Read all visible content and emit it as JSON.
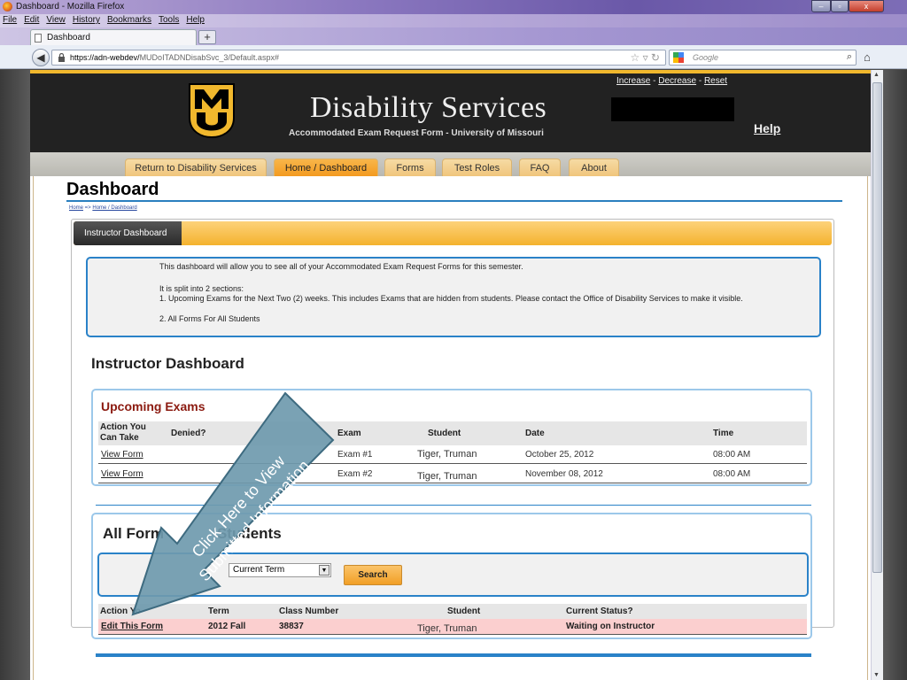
{
  "window": {
    "title": "Dashboard - Mozilla Firefox",
    "controls": {
      "minimize": "–",
      "maximize": "▫",
      "close": "x"
    }
  },
  "menu": [
    "File",
    "Edit",
    "View",
    "History",
    "Bookmarks",
    "Tools",
    "Help"
  ],
  "browser_tab": {
    "title": "Dashboard",
    "new_tab": "+"
  },
  "address": {
    "host": "https://adn-webdev/",
    "path": "MUDoITADNDisabSvc_3/Default.aspx#"
  },
  "search": {
    "placeholder": "Google"
  },
  "site": {
    "title": "Disability Services",
    "subtitle": "Accommodated Exam Request Form - University of Missouri",
    "font_controls": {
      "increase": "Increase",
      "sep": " - ",
      "decrease": "Decrease",
      "reset": "Reset"
    },
    "help": "Help"
  },
  "nav_tabs": [
    {
      "label": "Return to Disability Services"
    },
    {
      "label": "Home / Dashboard",
      "active": true
    },
    {
      "label": "Forms"
    },
    {
      "label": "Test Roles"
    },
    {
      "label": "FAQ"
    },
    {
      "label": "About"
    }
  ],
  "page": {
    "title": "Dashboard",
    "breadcrumb": {
      "home": "Home",
      "arrow": " => ",
      "current": "Home / Dashboard"
    },
    "panel_tab": "Instructor Dashboard",
    "intro": {
      "line1": "This dashboard will allow you to see all of your Accommodated Exam Request Forms for this semester.",
      "line2": "It is split into 2 sections:",
      "line3": "1.  Upcoming Exams for the Next Two (2) weeks. This includes Exams that are hidden from students. Please contact the Office of Disability Services to make it visible.",
      "line4": "2.  All Forms For All Students"
    },
    "section_title": "Instructor Dashboard"
  },
  "upcoming": {
    "title": "Upcoming Exams",
    "headers": {
      "action": "Action You Can Take",
      "denied": "Denied?",
      "exam": "Exam",
      "student": "Student",
      "date": "Date",
      "time": "Time"
    },
    "rows": [
      {
        "action": "View Form",
        "exam": "Exam #1",
        "student": "Tiger, Truman",
        "date": "October 25, 2012",
        "time": "08:00 AM"
      },
      {
        "action": "View Form",
        "exam": "Exam #2",
        "student": "Tiger, Truman",
        "date": "November 08, 2012",
        "time": "08:00 AM"
      }
    ]
  },
  "allforms": {
    "title_left": "All Form",
    "title_right": "Students",
    "term_selected": "Current Term",
    "search_button": "Search",
    "headers": {
      "action": "Action Yo",
      "term": "Term",
      "class_number": "Class Number",
      "student": "Student",
      "status": "Current Status?"
    },
    "row": {
      "action": "Edit This Form",
      "term": "2012 Fall",
      "class_number": "38837",
      "student": "Tiger, Truman",
      "status": "Waiting on Instructor"
    }
  },
  "callout": {
    "line1": "Click Here to View",
    "line2": "Submitted Information"
  },
  "colors": {
    "mizzou_gold": "#f1b82d",
    "header_bg": "#222222",
    "accent_blue": "#2a82c8",
    "status_row": "#fbcfcf",
    "callout": "#6f9aae"
  }
}
